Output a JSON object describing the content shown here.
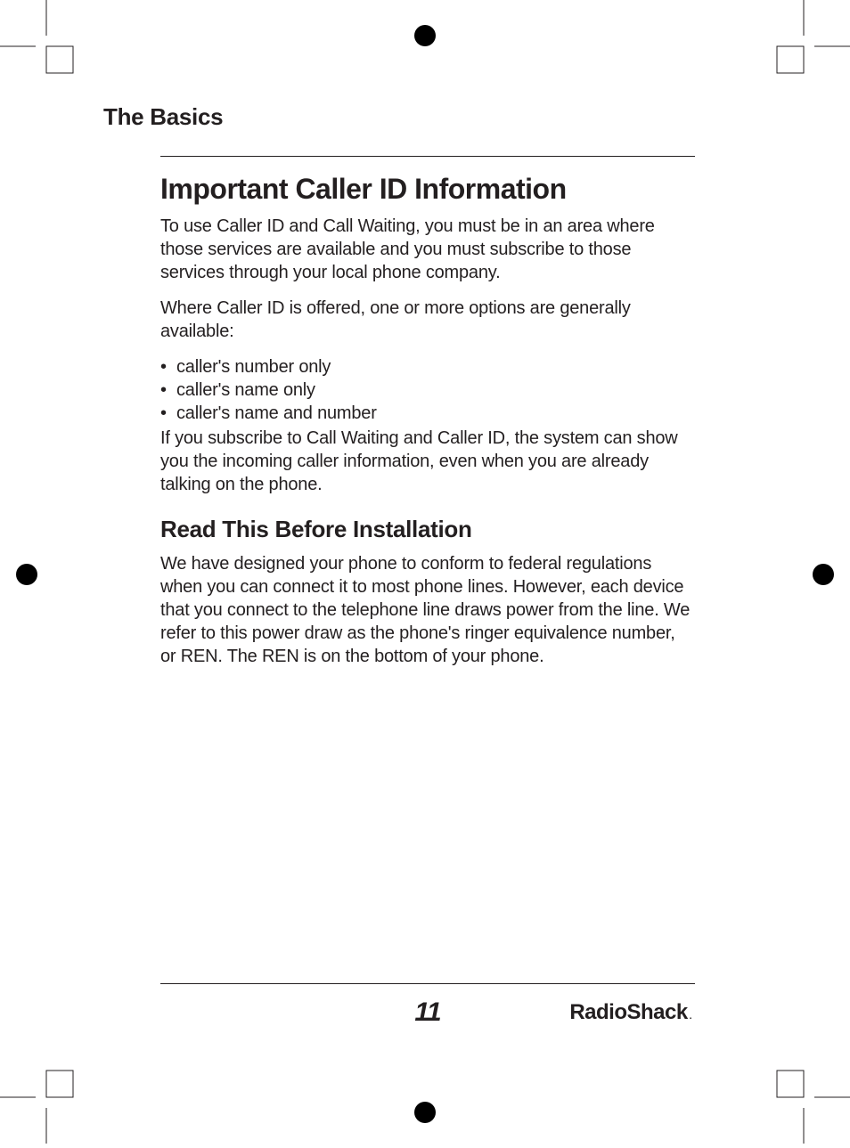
{
  "header": {
    "section": "The Basics"
  },
  "main": {
    "title": "Important Caller ID Information",
    "p1": "To use Caller ID and Call Waiting, you must be in an area where those services are available and you must subscribe to those services through your local phone company.",
    "p2": "Where Caller ID is offered, one or more options are generally available:",
    "bullets": {
      "0": "caller's number only",
      "1": "caller's name only",
      "2": "caller's name and number"
    },
    "p3": "If you subscribe to Call Waiting and Caller ID, the system can show you the incoming caller information, even when you are already talking on the phone.",
    "subhead": "Read This Before Installation",
    "p4": "We have designed your phone to conform to federal regulations when you can connect it to most phone lines. However, each device that you connect to the telephone line draws power from the line. We refer to this power draw as the phone's ringer equivalence number, or REN. The REN is on the bottom of your phone."
  },
  "footer": {
    "page": "11",
    "brand": "RadioShack",
    "brand_suffix": "."
  }
}
